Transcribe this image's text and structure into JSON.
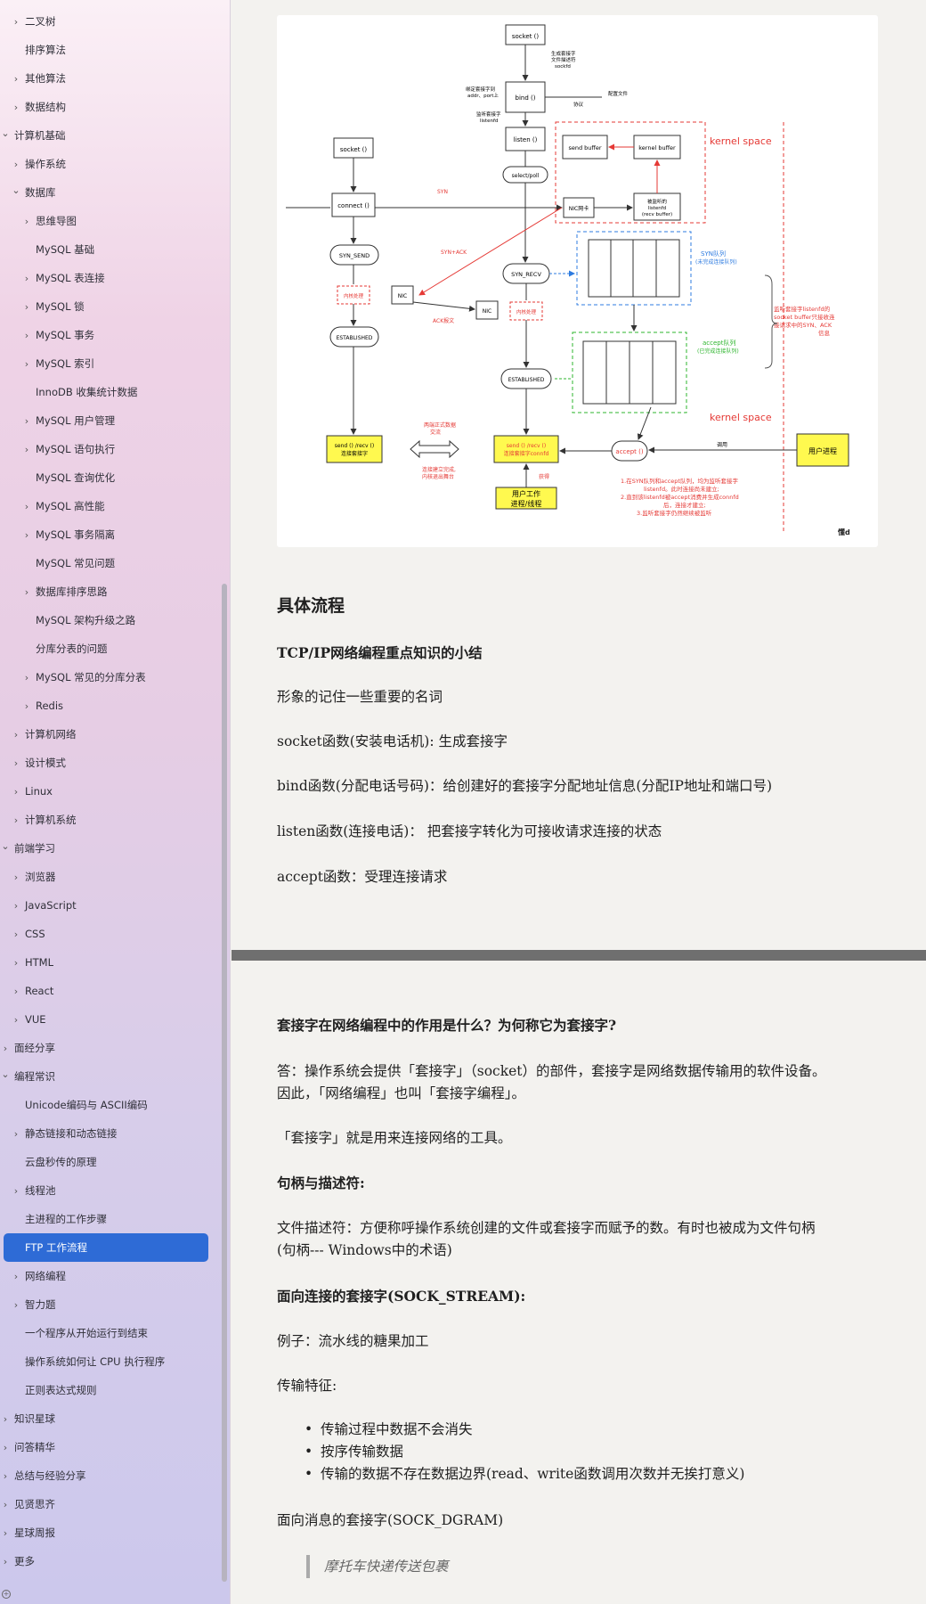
{
  "sidebar": {
    "items": [
      {
        "label": "二叉树",
        "level": 1,
        "chevron": "right"
      },
      {
        "label": "排序算法",
        "level": 1,
        "chevron": ""
      },
      {
        "label": "其他算法",
        "level": 1,
        "chevron": "right"
      },
      {
        "label": "数据结构",
        "level": 1,
        "chevron": "right"
      },
      {
        "label": "计算机基础",
        "level": 0,
        "chevron": "down"
      },
      {
        "label": "操作系统",
        "level": 1,
        "chevron": "right"
      },
      {
        "label": "数据库",
        "level": 1,
        "chevron": "down"
      },
      {
        "label": "思维导图",
        "level": 2,
        "chevron": "right"
      },
      {
        "label": "MySQL 基础",
        "level": 2,
        "chevron": ""
      },
      {
        "label": "MySQL 表连接",
        "level": 2,
        "chevron": "right"
      },
      {
        "label": "MySQL 锁",
        "level": 2,
        "chevron": "right"
      },
      {
        "label": "MySQL 事务",
        "level": 2,
        "chevron": "right"
      },
      {
        "label": "MySQL 索引",
        "level": 2,
        "chevron": "right"
      },
      {
        "label": "InnoDB 收集统计数据",
        "level": 2,
        "chevron": ""
      },
      {
        "label": "MySQL 用户管理",
        "level": 2,
        "chevron": "right"
      },
      {
        "label": "MySQL 语句执行",
        "level": 2,
        "chevron": "right"
      },
      {
        "label": "MySQL 查询优化",
        "level": 2,
        "chevron": ""
      },
      {
        "label": "MySQL 高性能",
        "level": 2,
        "chevron": "right"
      },
      {
        "label": "MySQL 事务隔离",
        "level": 2,
        "chevron": "right"
      },
      {
        "label": "MySQL 常见问题",
        "level": 2,
        "chevron": ""
      },
      {
        "label": "数据库排序思路",
        "level": 2,
        "chevron": "right"
      },
      {
        "label": "MySQL 架构升级之路",
        "level": 2,
        "chevron": ""
      },
      {
        "label": "分库分表的问题",
        "level": 2,
        "chevron": ""
      },
      {
        "label": "MySQL 常见的分库分表",
        "level": 2,
        "chevron": "right"
      },
      {
        "label": "Redis",
        "level": 2,
        "chevron": "right"
      },
      {
        "label": "计算机网络",
        "level": 1,
        "chevron": "right"
      },
      {
        "label": "设计模式",
        "level": 1,
        "chevron": "right"
      },
      {
        "label": "Linux",
        "level": 1,
        "chevron": "right"
      },
      {
        "label": "计算机系统",
        "level": 1,
        "chevron": "right"
      },
      {
        "label": "前端学习",
        "level": 0,
        "chevron": "down"
      },
      {
        "label": "浏览器",
        "level": 1,
        "chevron": "right"
      },
      {
        "label": "JavaScript",
        "level": 1,
        "chevron": "right"
      },
      {
        "label": "CSS",
        "level": 1,
        "chevron": "right"
      },
      {
        "label": "HTML",
        "level": 1,
        "chevron": "right"
      },
      {
        "label": "React",
        "level": 1,
        "chevron": "right"
      },
      {
        "label": "VUE",
        "level": 1,
        "chevron": "right"
      },
      {
        "label": "面经分享",
        "level": 0,
        "chevron": "right"
      },
      {
        "label": "编程常识",
        "level": 0,
        "chevron": "down"
      },
      {
        "label": "Unicode编码与 ASCII编码",
        "level": 1,
        "chevron": ""
      },
      {
        "label": "静态链接和动态链接",
        "level": 1,
        "chevron": "right"
      },
      {
        "label": "云盘秒传的原理",
        "level": 1,
        "chevron": ""
      },
      {
        "label": "线程池",
        "level": 1,
        "chevron": "right"
      },
      {
        "label": "主进程的工作步骤",
        "level": 1,
        "chevron": ""
      },
      {
        "label": "FTP 工作流程",
        "level": 1,
        "chevron": "",
        "active": true
      },
      {
        "label": "网络编程",
        "level": 1,
        "chevron": "right"
      },
      {
        "label": "智力题",
        "level": 1,
        "chevron": "right"
      },
      {
        "label": "一个程序从开始运行到结束",
        "level": 1,
        "chevron": ""
      },
      {
        "label": "操作系统如何让 CPU 执行程序",
        "level": 1,
        "chevron": ""
      },
      {
        "label": "正则表达式规则",
        "level": 1,
        "chevron": ""
      },
      {
        "label": "知识星球",
        "level": 0,
        "chevron": "right"
      },
      {
        "label": "问答精华",
        "level": 0,
        "chevron": "right"
      },
      {
        "label": "总结与经验分享",
        "level": 0,
        "chevron": "right"
      },
      {
        "label": "见贤思齐",
        "level": 0,
        "chevron": "right"
      },
      {
        "label": "星球周报",
        "level": 0,
        "chevron": "right"
      },
      {
        "label": "更多",
        "level": 0,
        "chevron": "right"
      }
    ]
  },
  "diagram": {
    "labels": {
      "socket_top": "socket ()",
      "gen_socket": "生成套接字",
      "file_desc": "文件描述符",
      "sockfd": "sockfd",
      "bind": "bind ()",
      "bind_addr": "绑定套接字到",
      "bind_addr2": "addr、port上",
      "listen_sockfd": "监听套接字",
      "listenfd": "listenfd",
      "listen": "listen ()",
      "select": "select/poll",
      "kernel_space_top": "kernel space",
      "send_buffer": "send buffer",
      "kernel_buffer": "kernel buffer",
      "nic_card": "NIC网卡",
      "listenfd_box": "被监听的",
      "listenfd_box2": "listenfd",
      "recv_buffer": "(recv buffer)",
      "socket_left": "socket ()",
      "connect": "connect ()",
      "syn_send": "SYN_SEND",
      "syn_recv": "SYN_RECV",
      "established_left": "ESTABLISHED",
      "established_mid": "ESTABLISHED",
      "send_recv_left": "send () /recv ()",
      "send_recv_left2": "连接套接字",
      "send_recv_mid": "send () /recv ()",
      "send_recv_mid2": "连接套接字connfd",
      "accept": "accept ()",
      "user_process": "用户进程",
      "user_work": "用户工作",
      "user_work2": "进程/线程",
      "syn_queue": "SYN队列",
      "syn_queue2": "(未完成连接队列)",
      "accept_queue": "accept队列",
      "accept_queue2": "(已完成连接队列)",
      "kernel_space_bottom": "kernel space",
      "listen_note1": "监听套接字listenfd的",
      "listen_note2": "socket buffer只接收连",
      "listen_note3": "接请求中的SYN、ACK",
      "listen_note4": "信息",
      "foot1": "1.在SYN队列和accept队列，均为监听套接字",
      "foot2": "listenfd。此时连接尚未建立;",
      "foot3": "2.直到该listenfd被accept消费并生成connfd",
      "foot4": "后，连接才建立;",
      "foot5": "3.监听套接字仍然继续被监听",
      "exchange": "两端正式数据",
      "exchange2": "交流",
      "done": "连接建立完成,",
      "done2": "内核退出舞台",
      "call": "调用",
      "get": "获得",
      "signature": "懂d",
      "syn_ack": "SYN+ACK",
      "ack": "ACK报文",
      "syn": "SYN",
      "nic_left": "NIC",
      "nic_mid": "NIC",
      "kernel_proc": "内核处理",
      "config_file": "配置文件",
      "protocol": "协议"
    }
  },
  "article": {
    "heading": "具体流程",
    "subtitle": "TCP/IP网络编程重点知识的小结",
    "p1": "形象的记住一些重要的名词",
    "p2": "socket函数(安装电话机): 生成套接字",
    "p3": "bind函数(分配电话号码)：给创建好的套接字分配地址信息(分配IP地址和端口号)",
    "p4": "listen函数(连接电话)： 把套接字转化为可接收请求连接的状态",
    "p5": "accept函数：受理连接请求",
    "q1": "套接字在网络编程中的作用是什么？为何称它为套接字?",
    "a1_line1": "答：操作系统会提供「套接字」（socket）的部件，套接字是网络数据传输用的软件设备。",
    "a1_line2": "因此，「网络编程」也叫「套接字编程」。",
    "p6": "「套接字」就是用来连接网络的工具。",
    "h_handle": "句柄与描述符:",
    "fd_line1": "文件描述符：方便称呼操作系统创建的文件或套接字而赋予的数。有时也被成为文件句柄",
    "fd_line2": "(句柄--- Windows中的术语)",
    "h_stream": "面向连接的套接字(SOCK_STREAM):",
    "example": "例子：流水线的糖果加工",
    "features": "传输特征:",
    "bullets": [
      "传输过程中数据不会消失",
      "按序传输数据",
      "传输的数据不存在数据边界(read、write函数调用次数并无挨打意义)"
    ],
    "dgram": "面向消息的套接字(SOCK_DGRAM)",
    "quote": "摩托车快递传送包裹"
  }
}
